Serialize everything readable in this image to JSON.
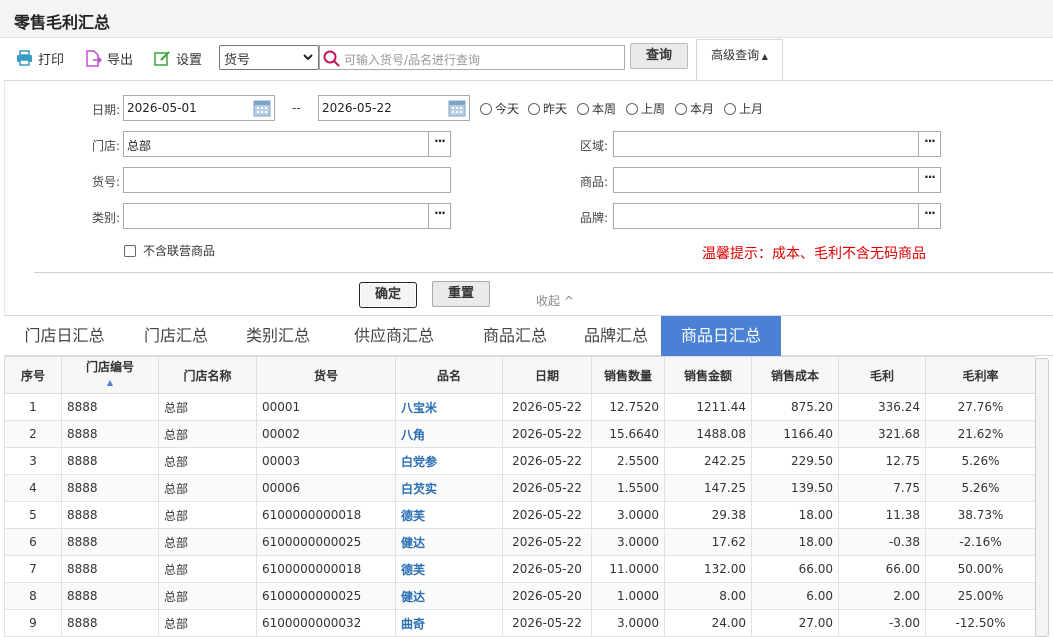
{
  "title": "零售毛利汇总",
  "toolbar": {
    "print": "打印",
    "export": "导出",
    "settings": "设置",
    "field_select": "货号",
    "search_placeholder": "可输入货号/品名进行查询",
    "query": "查询",
    "advanced": "高级查询"
  },
  "filter": {
    "date_label": "日期:",
    "date_from": "2026-05-01",
    "date_sep": "--",
    "date_to": "2026-05-22",
    "radios": [
      "今天",
      "昨天",
      "本周",
      "上周",
      "本月",
      "上月"
    ],
    "store_label": "门店:",
    "store_value": "总部",
    "region_label": "区域:",
    "sku_label": "货号:",
    "product_label": "商品:",
    "category_label": "类别:",
    "brand_label": "品牌:",
    "exclude_joint": "不含联营商品",
    "hint": "温馨提示：成本、毛利不含无码商品",
    "confirm": "确定",
    "reset": "重置",
    "collapse": "收起"
  },
  "tabs": [
    "门店日汇总",
    "门店汇总",
    "类别汇总",
    "供应商汇总",
    "商品汇总",
    "品牌汇总",
    "商品日汇总"
  ],
  "active_tab": 6,
  "table": {
    "columns": [
      "序号",
      "门店编号",
      "门店名称",
      "货号",
      "品名",
      "日期",
      "销售数量",
      "销售金额",
      "销售成本",
      "毛利",
      "毛利率"
    ],
    "rows": [
      [
        "1",
        "8888",
        "总部",
        "00001",
        "八宝米",
        "2026-05-22",
        "12.7520",
        "1211.44",
        "875.20",
        "336.24",
        "27.76%"
      ],
      [
        "2",
        "8888",
        "总部",
        "00002",
        "八角",
        "2026-05-22",
        "15.6640",
        "1488.08",
        "1166.40",
        "321.68",
        "21.62%"
      ],
      [
        "3",
        "8888",
        "总部",
        "00003",
        "白党参",
        "2026-05-22",
        "2.5500",
        "242.25",
        "229.50",
        "12.75",
        "5.26%"
      ],
      [
        "4",
        "8888",
        "总部",
        "00006",
        "白芡实",
        "2026-05-22",
        "1.5500",
        "147.25",
        "139.50",
        "7.75",
        "5.26%"
      ],
      [
        "5",
        "8888",
        "总部",
        "6100000000018",
        "德芙",
        "2026-05-22",
        "3.0000",
        "29.38",
        "18.00",
        "11.38",
        "38.73%"
      ],
      [
        "6",
        "8888",
        "总部",
        "6100000000025",
        "健达",
        "2026-05-22",
        "3.0000",
        "17.62",
        "18.00",
        "-0.38",
        "-2.16%"
      ],
      [
        "7",
        "8888",
        "总部",
        "6100000000018",
        "德芙",
        "2026-05-20",
        "11.0000",
        "132.00",
        "66.00",
        "66.00",
        "50.00%"
      ],
      [
        "8",
        "8888",
        "总部",
        "6100000000025",
        "健达",
        "2026-05-20",
        "1.0000",
        "8.00",
        "6.00",
        "2.00",
        "25.00%"
      ],
      [
        "9",
        "8888",
        "总部",
        "6100000000032",
        "曲奇",
        "2026-05-22",
        "3.0000",
        "24.00",
        "27.00",
        "-3.00",
        "-12.50%"
      ]
    ]
  },
  "colors": {
    "accent": "#4a81d4",
    "link": "#2a6eb3",
    "hint": "#dd0000"
  }
}
